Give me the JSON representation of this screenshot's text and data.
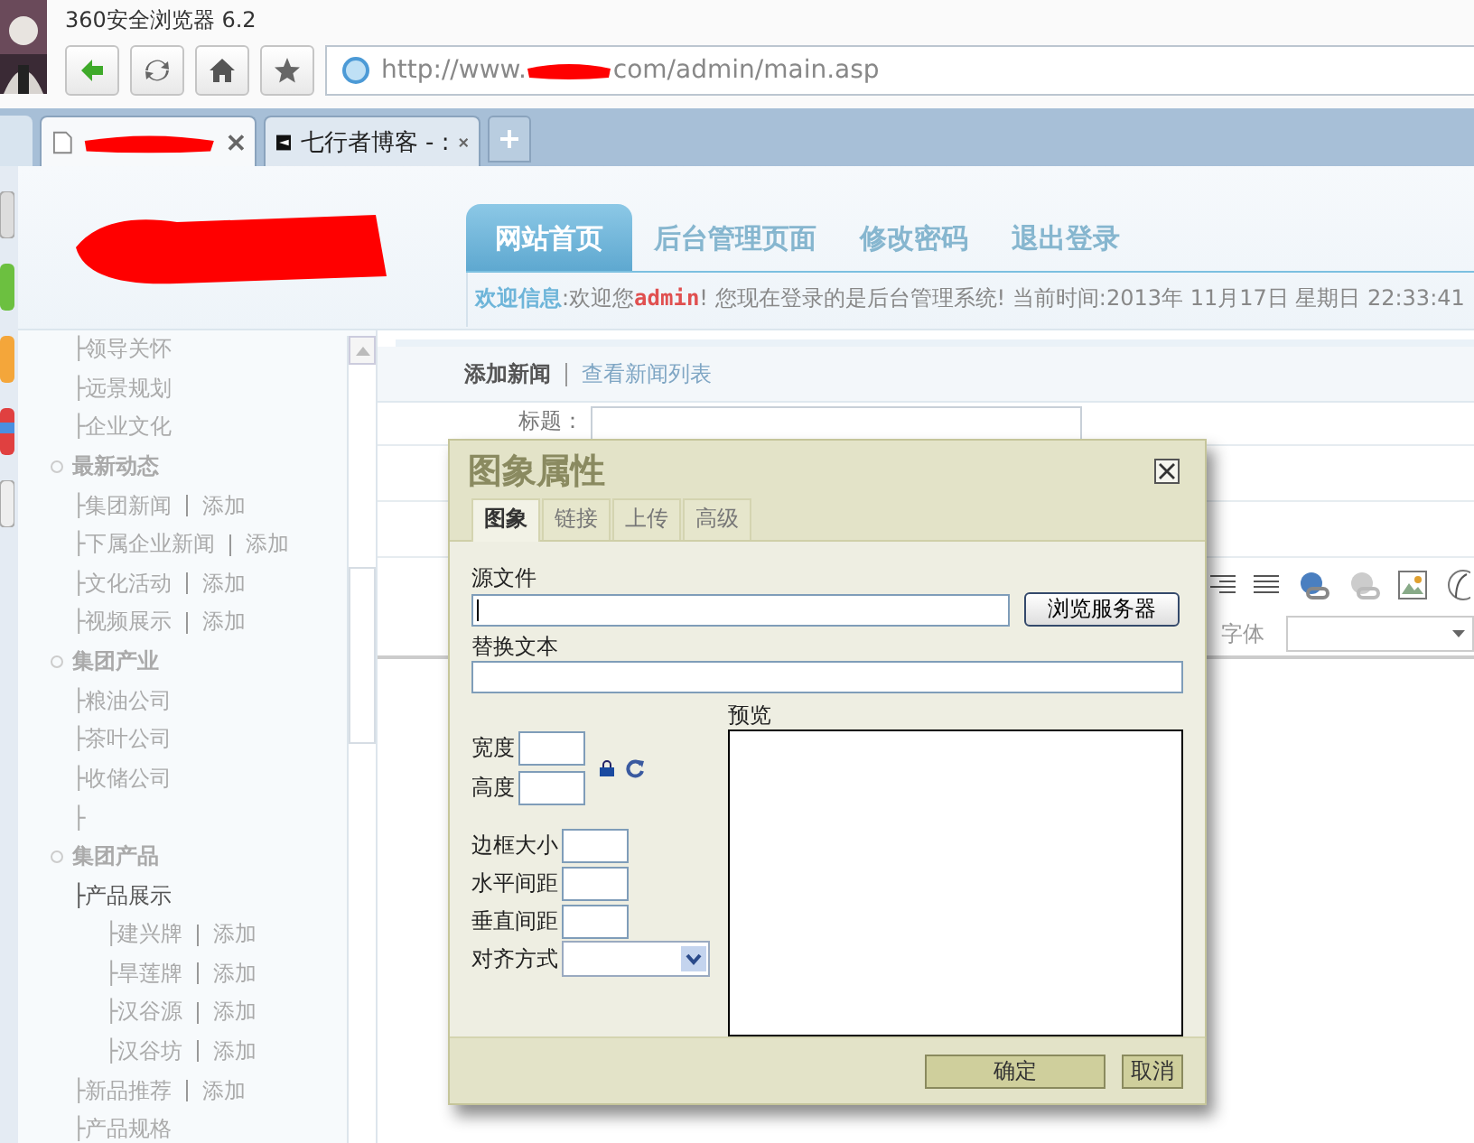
{
  "browser": {
    "title": "360安全浏览器 6.2",
    "address": {
      "before": "http://www.",
      "after": "com/admin/main.asp"
    },
    "tabs": [
      {
        "kind": "redacted",
        "selected": true
      },
      {
        "kind": "page",
        "label": "七行者博客 - :",
        "selected": false
      }
    ]
  },
  "header": {
    "nav": [
      {
        "label": "网站首页",
        "selected": true
      },
      {
        "label": "后台管理页面",
        "selected": false
      },
      {
        "label": "修改密码",
        "selected": false
      },
      {
        "label": "退出登录",
        "selected": false
      }
    ],
    "welcome_label": "欢迎信息",
    "welcome_text": ":欢迎您**admin**! 您现在登录的是后台管理系统! 当前时间:2013年 11月17日 星期日 22:33:41"
  },
  "sidebar": [
    {
      "kind": "item",
      "label": "├领导关怀"
    },
    {
      "kind": "item",
      "label": "├远景规划"
    },
    {
      "kind": "item",
      "label": "├企业文化"
    },
    {
      "kind": "section",
      "label": "最新动态"
    },
    {
      "kind": "item",
      "label": "├集团新闻",
      "link": "添加"
    },
    {
      "kind": "item",
      "label": "├下属企业新闻",
      "link": "添加"
    },
    {
      "kind": "item",
      "label": "├文化活动",
      "link": "添加"
    },
    {
      "kind": "item",
      "label": "├视频展示",
      "link": "添加"
    },
    {
      "kind": "section",
      "label": "集团产业"
    },
    {
      "kind": "item",
      "label": "├粮油公司"
    },
    {
      "kind": "item",
      "label": "├茶叶公司"
    },
    {
      "kind": "item",
      "label": "├收储公司"
    },
    {
      "kind": "item",
      "label": "├"
    },
    {
      "kind": "section",
      "label": "集团产品"
    },
    {
      "kind": "item",
      "label": "├产品展示",
      "children": [
        {
          "label": "├建兴牌",
          "link": "添加"
        },
        {
          "label": "├旱莲牌",
          "link": "添加"
        },
        {
          "label": "├汉谷源",
          "link": "添加"
        },
        {
          "label": "├汉谷坊",
          "link": "添加"
        }
      ]
    },
    {
      "kind": "item",
      "label": "├新品推荐",
      "link": "添加"
    },
    {
      "kind": "item",
      "label": "├产品规格"
    }
  ],
  "content": {
    "current": "添加新闻",
    "link": "查看新闻列表",
    "title_label": "标题：",
    "font_label": "字体"
  },
  "dialog": {
    "title": "图象属性",
    "tabs": [
      {
        "label": "图象",
        "selected": true
      },
      {
        "label": "链接",
        "selected": false
      },
      {
        "label": "上传",
        "selected": false
      },
      {
        "label": "高级",
        "selected": false
      }
    ],
    "source_label": "源文件",
    "browse_button": "浏览服务器",
    "alt_label": "替换文本",
    "size_fields": [
      {
        "label": "宽度"
      },
      {
        "label": "高度"
      }
    ],
    "spacing_fields": [
      {
        "label": "边框大小"
      },
      {
        "label": "水平间距"
      },
      {
        "label": "垂直间距"
      }
    ],
    "align_label": "对齐方式",
    "preview_label": "预览",
    "buttons": [
      {
        "label": "确定",
        "kind": "primary"
      },
      {
        "label": "取消",
        "kind": "secondary"
      }
    ]
  }
}
